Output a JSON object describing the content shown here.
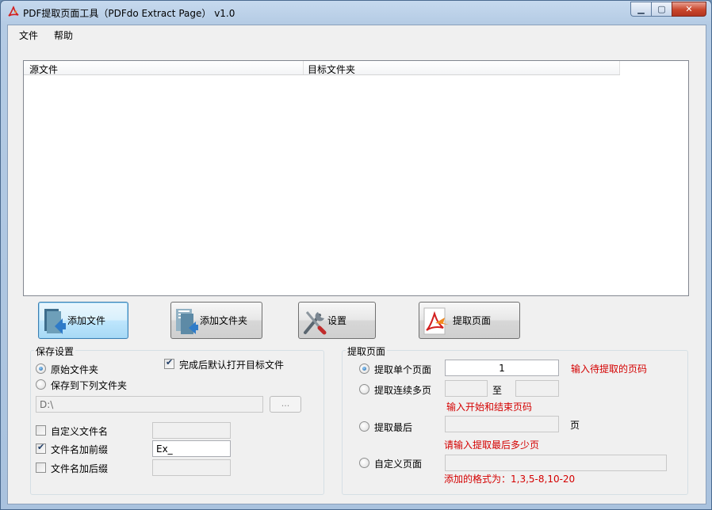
{
  "window": {
    "title": "PDF提取页面工具（PDFdo Extract Page） v1.0",
    "min_icon": "minimize-icon",
    "max_icon": "maximize-icon",
    "close_icon": "close-icon"
  },
  "menu": {
    "file": "文件",
    "help": "帮助"
  },
  "file_list": {
    "columns": [
      "源文件",
      "目标文件夹"
    ]
  },
  "buttons": {
    "add_file": "添加文件",
    "add_folder": "添加文件夹",
    "settings": "设置",
    "extract": "提取页面"
  },
  "save_settings": {
    "title": "保存设置",
    "original_folder": "原始文件夹",
    "save_to_folder": "保存到下列文件夹",
    "open_after": "完成后默认打开目标文件",
    "folder_path": "D:\\",
    "browse": "...",
    "custom_name": "自定义文件名",
    "custom_name_value": "",
    "add_prefix": "文件名加前缀",
    "prefix_value": "Ex_",
    "add_suffix": "文件名加后缀",
    "suffix_value": ""
  },
  "extract_pages": {
    "title": "提取页面",
    "single_page": "提取单个页面",
    "single_page_value": "1",
    "single_hint": "输入待提取的页码",
    "multi_pages": "提取连续多页",
    "multi_from": "",
    "to": "至",
    "multi_to": "",
    "multi_hint": "输入开始和结束页码",
    "last_pages": "提取最后",
    "last_value": "",
    "page_unit": "页",
    "last_hint": "请输入提取最后多少页",
    "custom_pages": "自定义页面",
    "custom_value": "",
    "custom_hint": "添加的格式为：1,3,5-8,10-20"
  },
  "colors": {
    "hint_red": "#d40000",
    "accent": "#3c7fb1"
  }
}
